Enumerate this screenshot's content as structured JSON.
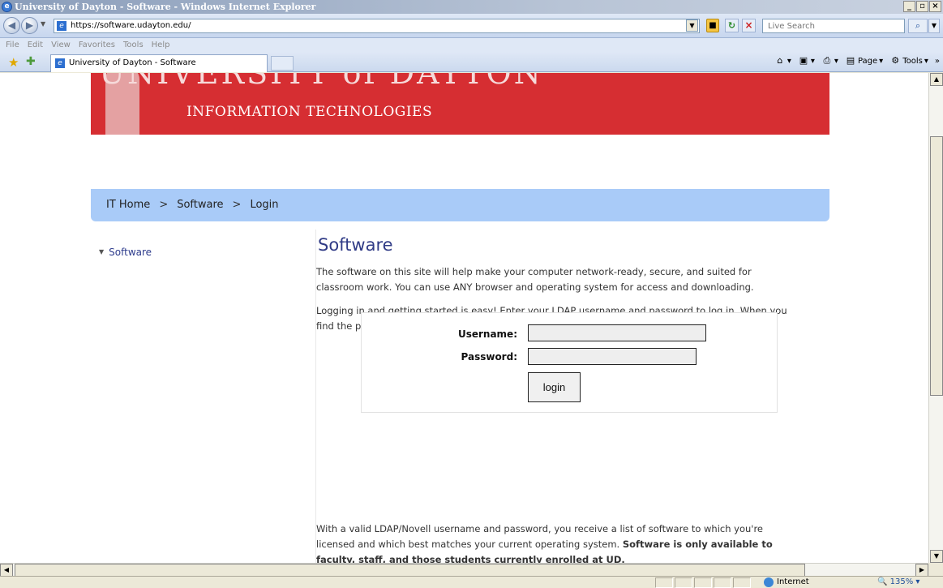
{
  "window": {
    "title": "University of Dayton - Software - Windows Internet Explorer",
    "minimize": "_",
    "maximize": "▫",
    "close": "×"
  },
  "address": {
    "url": "https://software.udayton.edu/",
    "search_placeholder": "Live Search"
  },
  "menu": [
    "File",
    "Edit",
    "View",
    "Favorites",
    "Tools",
    "Help"
  ],
  "tab": {
    "label": "University of Dayton - Software"
  },
  "commands": {
    "page": "Page",
    "tools": "Tools"
  },
  "banner": {
    "university": "UNIVERSITY of DAYTON",
    "subtitle": "INFORMATION TECHNOLOGIES"
  },
  "breadcrumb": {
    "items": [
      "IT Home",
      "Software",
      "Login"
    ],
    "separator": ">"
  },
  "sidebar": {
    "items": [
      {
        "label": "Software"
      }
    ]
  },
  "main": {
    "title": "Software",
    "para1": "The software on this site will help make your computer network-ready, secure, and suited for classroom work. You can use ANY browser and operating system for access and downloading.",
    "para2": "Logging in and getting started is easy! Enter your LDAP username and password to log in. When you find the piece of software you're looking for, click the green download arrow.",
    "bottom_text": "With a valid LDAP/Novell username and password, you receive a list of software to which you're licensed and which best matches your current operating system.",
    "bottom_bold": "Software is only available to faculty, staff, and those students currently enrolled at UD."
  },
  "login": {
    "username_label": "Username:",
    "password_label": "Password:",
    "username_value": "",
    "password_value": "",
    "button_label": "login"
  },
  "status": {
    "zone": "Internet",
    "zoom": "135%"
  },
  "colors": {
    "banner": "#d62e32",
    "breadcrumb_bg": "#a9cbf8",
    "title": "#303b86"
  }
}
